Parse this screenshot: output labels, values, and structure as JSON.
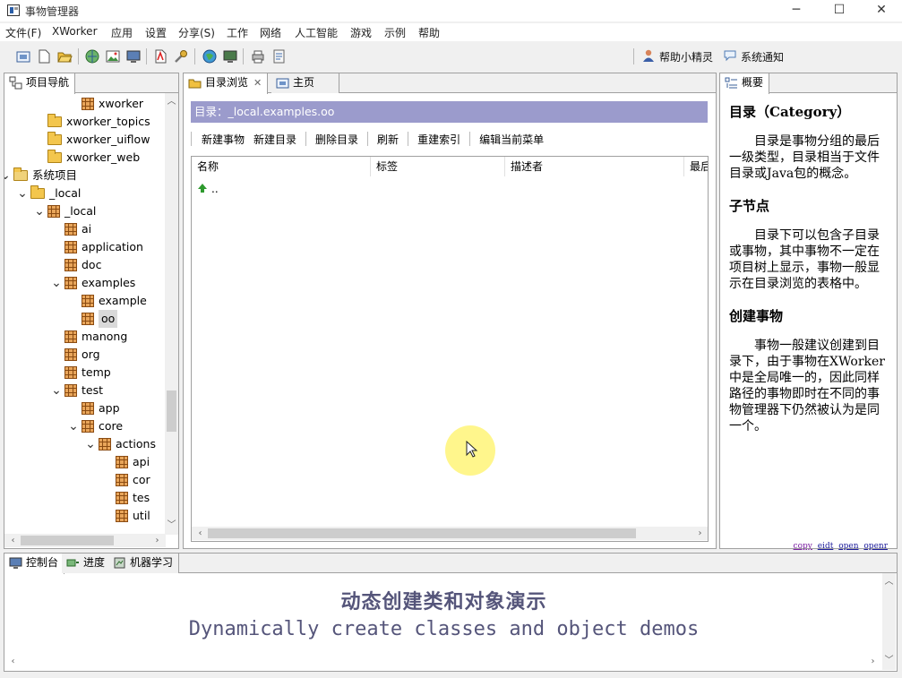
{
  "window": {
    "title": "事物管理器",
    "minimize": "─",
    "maximize": "☐",
    "close": "✕"
  },
  "menu": [
    "文件(F)",
    "XWorker",
    "应用",
    "设置",
    "分享(S)",
    "工作",
    "网络",
    "人工智能",
    "游戏",
    "示例",
    "帮助"
  ],
  "toolbar": {
    "help_label": "帮助小精灵",
    "notify_label": "系统通知"
  },
  "left_panel": {
    "tab": "项目导航",
    "tree": [
      {
        "label": "xworker",
        "icon": "package",
        "depth": 4,
        "twisty": ""
      },
      {
        "label": "xworker_topics",
        "icon": "folder",
        "depth": 2,
        "twisty": ""
      },
      {
        "label": "xworker_uiflow",
        "icon": "folder",
        "depth": 2,
        "twisty": ""
      },
      {
        "label": "xworker_web",
        "icon": "folder",
        "depth": 2,
        "twisty": ""
      },
      {
        "label": "系统项目",
        "icon": "sysfolder",
        "depth": 0,
        "twisty": "v"
      },
      {
        "label": "_local",
        "icon": "folder",
        "depth": 1,
        "twisty": "v"
      },
      {
        "label": "_local",
        "icon": "package",
        "depth": 2,
        "twisty": "v"
      },
      {
        "label": "ai",
        "icon": "package",
        "depth": 3,
        "twisty": ""
      },
      {
        "label": "application",
        "icon": "package",
        "depth": 3,
        "twisty": ""
      },
      {
        "label": "doc",
        "icon": "package",
        "depth": 3,
        "twisty": ""
      },
      {
        "label": "examples",
        "icon": "package",
        "depth": 3,
        "twisty": "v"
      },
      {
        "label": "example",
        "icon": "package",
        "depth": 4,
        "twisty": ""
      },
      {
        "label": "oo",
        "icon": "package",
        "depth": 4,
        "twisty": "",
        "selected": true
      },
      {
        "label": "manong",
        "icon": "package",
        "depth": 3,
        "twisty": ""
      },
      {
        "label": "org",
        "icon": "package",
        "depth": 3,
        "twisty": ""
      },
      {
        "label": "temp",
        "icon": "package",
        "depth": 3,
        "twisty": ""
      },
      {
        "label": "test",
        "icon": "package",
        "depth": 3,
        "twisty": "v"
      },
      {
        "label": "app",
        "icon": "package",
        "depth": 4,
        "twisty": ""
      },
      {
        "label": "core",
        "icon": "package",
        "depth": 4,
        "twisty": "v"
      },
      {
        "label": "actions",
        "icon": "package",
        "depth": 5,
        "twisty": "v"
      },
      {
        "label": "api",
        "icon": "package",
        "depth": 6,
        "twisty": ""
      },
      {
        "label": "cor",
        "icon": "package",
        "depth": 6,
        "twisty": ""
      },
      {
        "label": "tes",
        "icon": "package",
        "depth": 6,
        "twisty": ""
      },
      {
        "label": "util",
        "icon": "package",
        "depth": 6,
        "twisty": ""
      }
    ]
  },
  "middle_panel": {
    "tabs": [
      {
        "label": "目录浏览",
        "close": "✕"
      },
      {
        "label": "主页"
      }
    ],
    "dir_label": "目录：_local.examples.oo",
    "actions": [
      "新建事物",
      "新建目录",
      "删除目录",
      "刷新",
      "重建索引",
      "编辑当前菜单"
    ],
    "columns": [
      "名称",
      "标签",
      "描述者",
      "最后"
    ],
    "rows": [
      ".."
    ]
  },
  "right_panel": {
    "tab": "概要",
    "sections": [
      {
        "heading": "目录（Category）",
        "text": "目录是事物分组的最后一级类型，目录相当于文件目录或Java包的概念。"
      },
      {
        "heading": "子节点",
        "text": "目录下可以包含子目录或事物，其中事物不一定在项目树上显示，事物一般显示在目录浏览的表格中。"
      },
      {
        "heading": "创建事物",
        "text": "事物一般建议创建到目录下，由于事物在XWorker中是全局唯一的，因此同样路径的事物即时在不同的事物管理器下仍然被认为是同一个。"
      }
    ],
    "links": [
      "copy",
      "eidt",
      "open",
      "openr"
    ]
  },
  "bottom_panel": {
    "tabs": [
      "控制台",
      "进度",
      "机器学习"
    ],
    "caption_cn": "动态创建类和对象演示",
    "caption_en": "Dynamically create classes and object demos"
  }
}
